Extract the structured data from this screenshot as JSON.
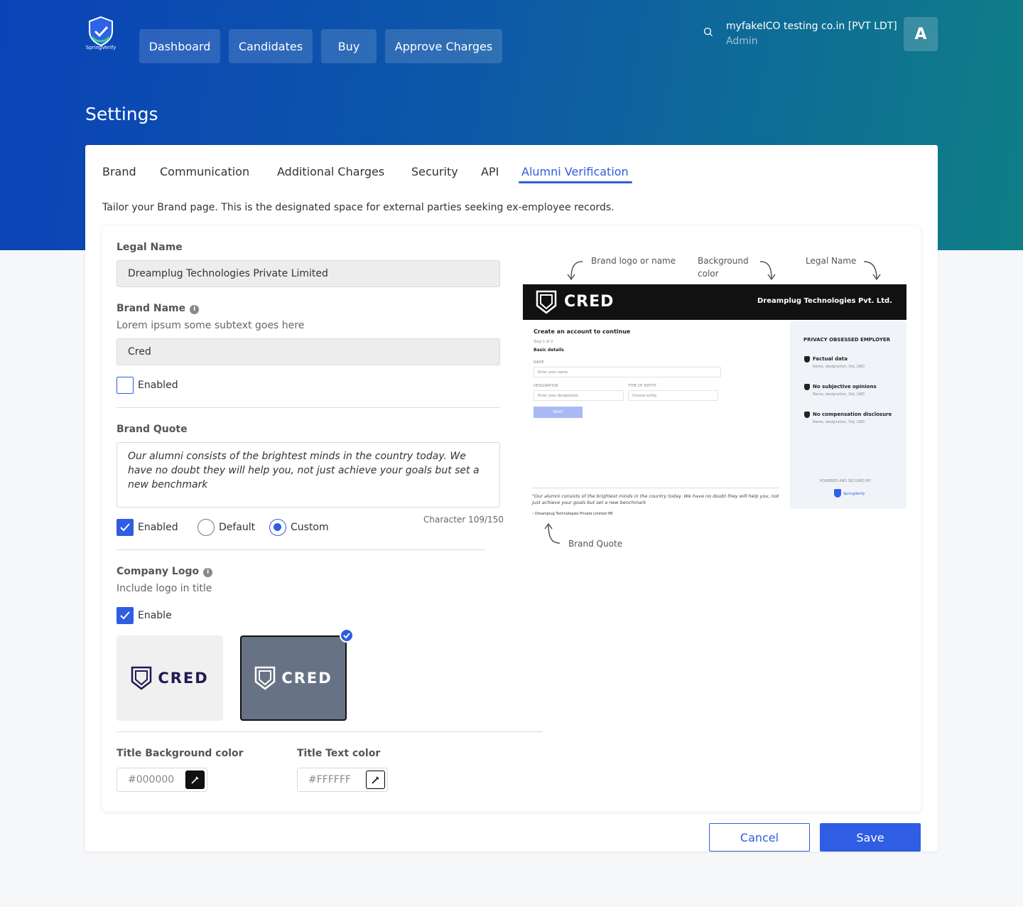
{
  "brand": {
    "logo_text": "SpringVerify"
  },
  "nav": {
    "items": [
      "Dashboard",
      "Candidates",
      "Buy",
      "Approve Charges"
    ]
  },
  "user": {
    "org_name": "myfakeICO testing co.in [PVT LDT]",
    "role": "Admin",
    "avatar_letter": "A"
  },
  "page": {
    "title": "Settings"
  },
  "tabs": [
    "Brand",
    "Communication",
    "Additional Charges",
    "Security",
    "API",
    "Alumni Verification"
  ],
  "active_tab": "Alumni Verification",
  "intro": "Tailor your Brand page. This is the designated space for external parties seeking ex-employee records.",
  "form": {
    "legal_name_label": "Legal Name",
    "legal_name_value": "Dreamplug Technologies Private Limited",
    "brand_name_label": "Brand Name",
    "brand_name_subtext": "Lorem ipsum some subtext goes here",
    "brand_name_value": "Cred",
    "brand_enabled_label": "Enabled",
    "brand_quote_label": "Brand Quote",
    "brand_quote_value": "Our alumni consists of the brightest minds in the country today. We have no doubt they will help you, not just achieve your goals but set a new benchmark",
    "quote_enabled_label": "Enabled",
    "radio_default_label": "Default",
    "radio_custom_label": "Custom",
    "char_count": "Character 109/150",
    "company_logo_label": "Company Logo",
    "company_logo_subtext": "Include logo in title",
    "logo_enable_label": "Enable",
    "logo_wordmark": "CRED",
    "title_bg_label": "Title Background color",
    "title_bg_value": "#000000",
    "title_text_label": "Title Text color",
    "title_text_value": "#FFFFFF"
  },
  "preview": {
    "ann_brand_logo": "Brand logo or name",
    "ann_bg_color_1": "Background",
    "ann_bg_color_2": "color",
    "ann_legal_name": "Legal Name",
    "ann_brand_quote": "Brand Quote",
    "wordmark": "CRED",
    "legal_name": "Dreamplug Technologies Pvt. Ltd.",
    "form_title": "Create an account to continue",
    "step": "Step 1 of 2",
    "step_title": "Basic details",
    "name_label": "NAME",
    "name_placeholder": "Enter your name",
    "designation_label": "DESIGNATION",
    "designation_placeholder": "Enter your designation",
    "entity_label": "TYPE OF ENTITY",
    "entity_placeholder": "Choose entity",
    "next_button": "Next",
    "side_title": "PRIVACY OBSESSED EMPLOYER",
    "side_items": [
      {
        "title": "Factual data",
        "sub": "Name, designation, DoJ, LWD"
      },
      {
        "title": "No subjective opinions",
        "sub": "Name, designation, DoJ, LWD"
      },
      {
        "title": "No compensation disclosure",
        "sub": "Name, designation, DoJ, LWD"
      }
    ],
    "powered_by": "POWERED AND SECURED BY",
    "powered_logo": "SpringVerify",
    "quote_line": "\"Our alumni consists of the brightest minds in the country today. We have no doubt they will help you, not just achieve your goals but set a new benchmark",
    "quote_author": "– Dreamplug Technologies Private Limited HR"
  },
  "actions": {
    "cancel": "Cancel",
    "save": "Save"
  },
  "colors": {
    "primary": "#2f5de3",
    "hero_start": "#0a43b8",
    "hero_end": "#0f7f86",
    "logo_dark_tile": "#677385",
    "logo_ink": "#201a52"
  }
}
